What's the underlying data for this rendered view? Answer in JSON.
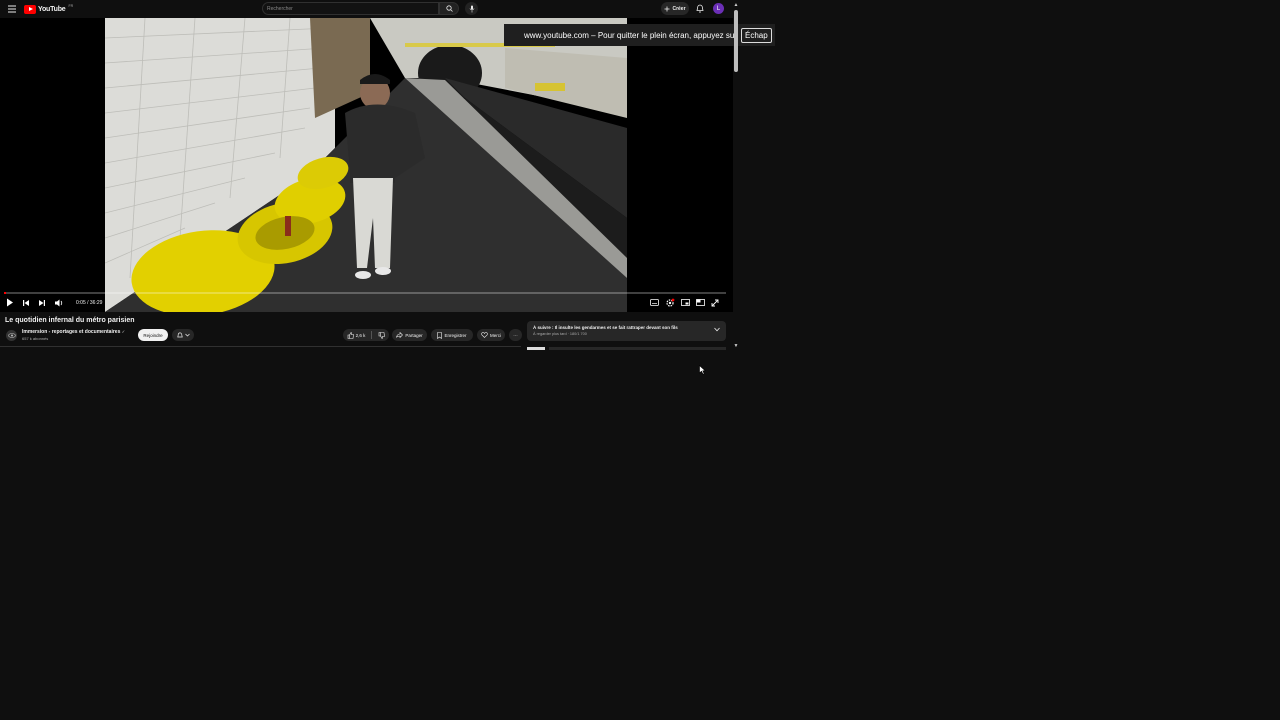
{
  "header": {
    "logo_text": "YouTube",
    "logo_country": "FR",
    "search_placeholder": "Rechercher",
    "create_label": "Créer",
    "avatar_letter": "L"
  },
  "notice": {
    "message": "www.youtube.com – Pour quitter le plein écran, appuyez sur",
    "key": "Échap"
  },
  "player": {
    "time": "0:05 / 36:29",
    "progress_fraction": 0.0023
  },
  "video": {
    "title": "Le quotidien infernal du métro parisien",
    "channel_name": "Immersion - reportages et documentaires",
    "verified_mark": "✓",
    "subscribers": "657 k abonnés",
    "join_label": "Rejoindre",
    "like_count": "2,6 k",
    "share_label": "Partager",
    "save_label": "Enregistrer",
    "thanks_label": "Merci",
    "more_label": "···"
  },
  "up_next": {
    "title": "À suivre : Il insulte les gendarmes et se fait rattraper devant son fils",
    "subtitle": "À regarder plus tard · 180/1 700"
  },
  "colors": {
    "accent": "#ff0000",
    "background": "#0f0f0f",
    "chip": "#272727",
    "seat_yellow": "#e2d000"
  }
}
